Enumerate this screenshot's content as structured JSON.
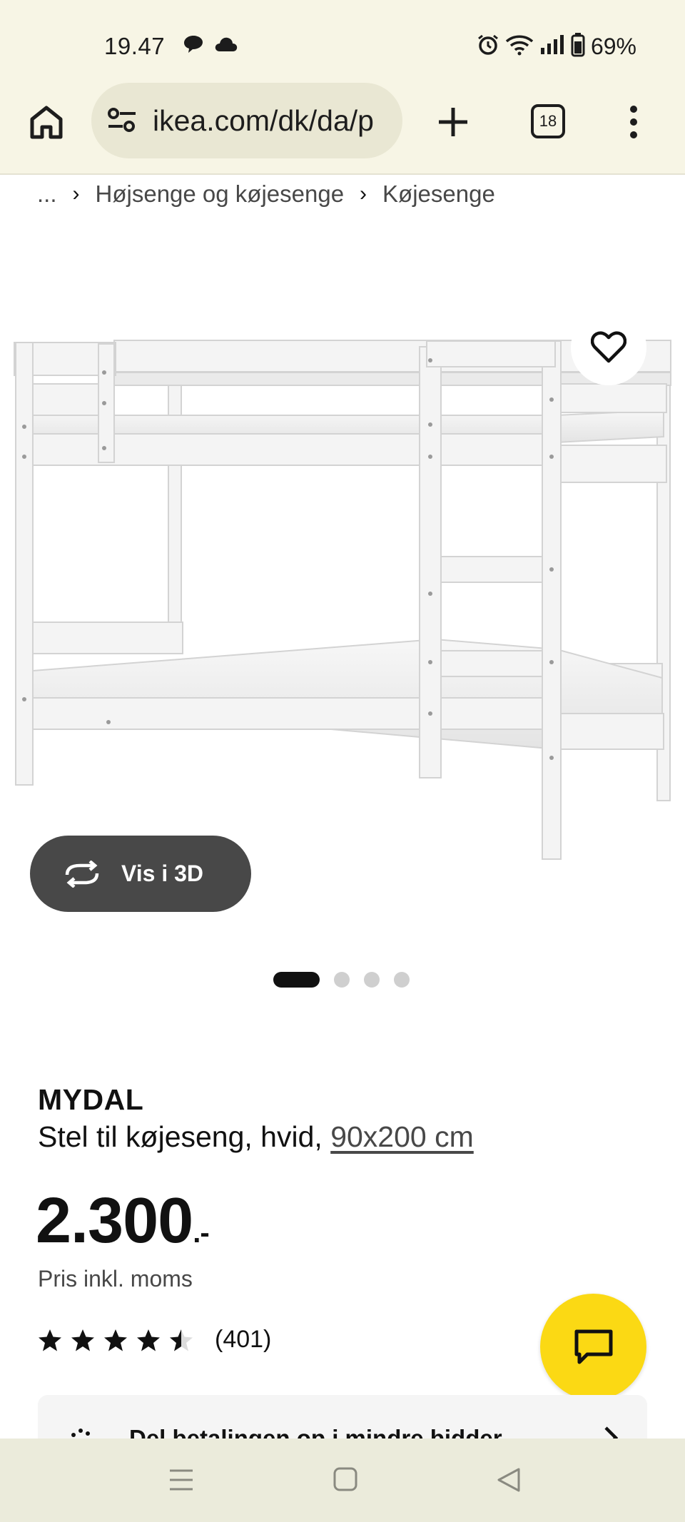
{
  "status_bar": {
    "time": "19.47",
    "battery": "69%",
    "icons": [
      "chat-bubble-icon",
      "cloud-icon",
      "alarm-icon",
      "wifi-icon",
      "signal-icon",
      "battery-icon"
    ]
  },
  "browser": {
    "url": "ikea.com/dk/da/p",
    "tab_count": "18",
    "icons": [
      "home-icon",
      "site-settings-icon",
      "plus-icon",
      "tabs-icon",
      "more-vert-icon"
    ]
  },
  "breadcrumb": {
    "items": [
      "...",
      "Højsenge og køjesenge",
      "Køjesenge"
    ],
    "separator": "›"
  },
  "gallery": {
    "view_3d_label": "Vis i 3D",
    "slide_count": 4,
    "active_slide": 1
  },
  "product": {
    "name": "MYDAL",
    "description": "Stel til køjeseng, hvid,",
    "size": "90x200 cm",
    "price": "2.300",
    "price_suffix": ".-",
    "price_note": "Pris inkl. moms",
    "rating_value": 4.5,
    "rating_max": 5,
    "review_count": "(401)"
  },
  "payment_banner": {
    "text": "Del betalingen op i mindre bidder"
  },
  "colors": {
    "browser_chrome": "#f7f5e5",
    "url_pill": "#e9e7d3",
    "ikea_yellow": "#fbd914",
    "button_dark": "#484848",
    "text": "#111111"
  }
}
